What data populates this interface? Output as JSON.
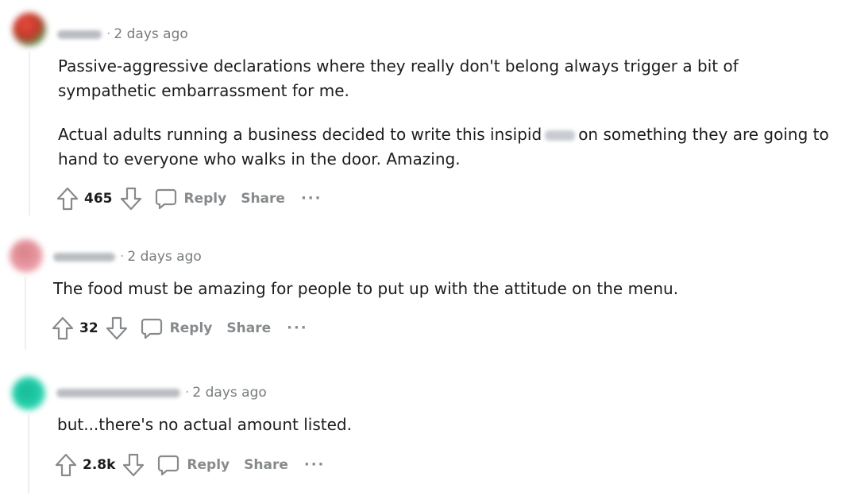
{
  "comments": [
    {
      "time": "2 days ago",
      "avatar_color": "#c0392b",
      "paragraphs": [
        "Passive-aggressive declarations where they really don't belong always trigger a bit of",
        "sympathetic embarrassment for me."
      ],
      "para2_before": "Actual adults running a business decided to write this insipid",
      "para2_after": "on something they are going to",
      "para2_line2": "hand to everyone who walks in the door. Amazing.",
      "votes": "465",
      "reply_label": "Reply",
      "share_label": "Share",
      "more_label": "···"
    },
    {
      "time": "2 days ago",
      "avatar_color": "#e58a95",
      "text": "The food must be amazing for people to put up with the attitude on the menu.",
      "votes": "32",
      "reply_label": "Reply",
      "share_label": "Share",
      "more_label": "···"
    },
    {
      "time": "2 days ago",
      "avatar_color": "#1fcca6",
      "text": "but...there's no actual amount listed.",
      "votes": "2.8k",
      "reply_label": "Reply",
      "share_label": "Share",
      "more_label": "···"
    }
  ],
  "colors": {
    "text": "#1c1c1c",
    "muted": "#878a8c",
    "thread_line": "#edeff1"
  },
  "icons": [
    "upvote-icon",
    "downvote-icon",
    "comment-bubble-icon",
    "more-icon"
  ]
}
